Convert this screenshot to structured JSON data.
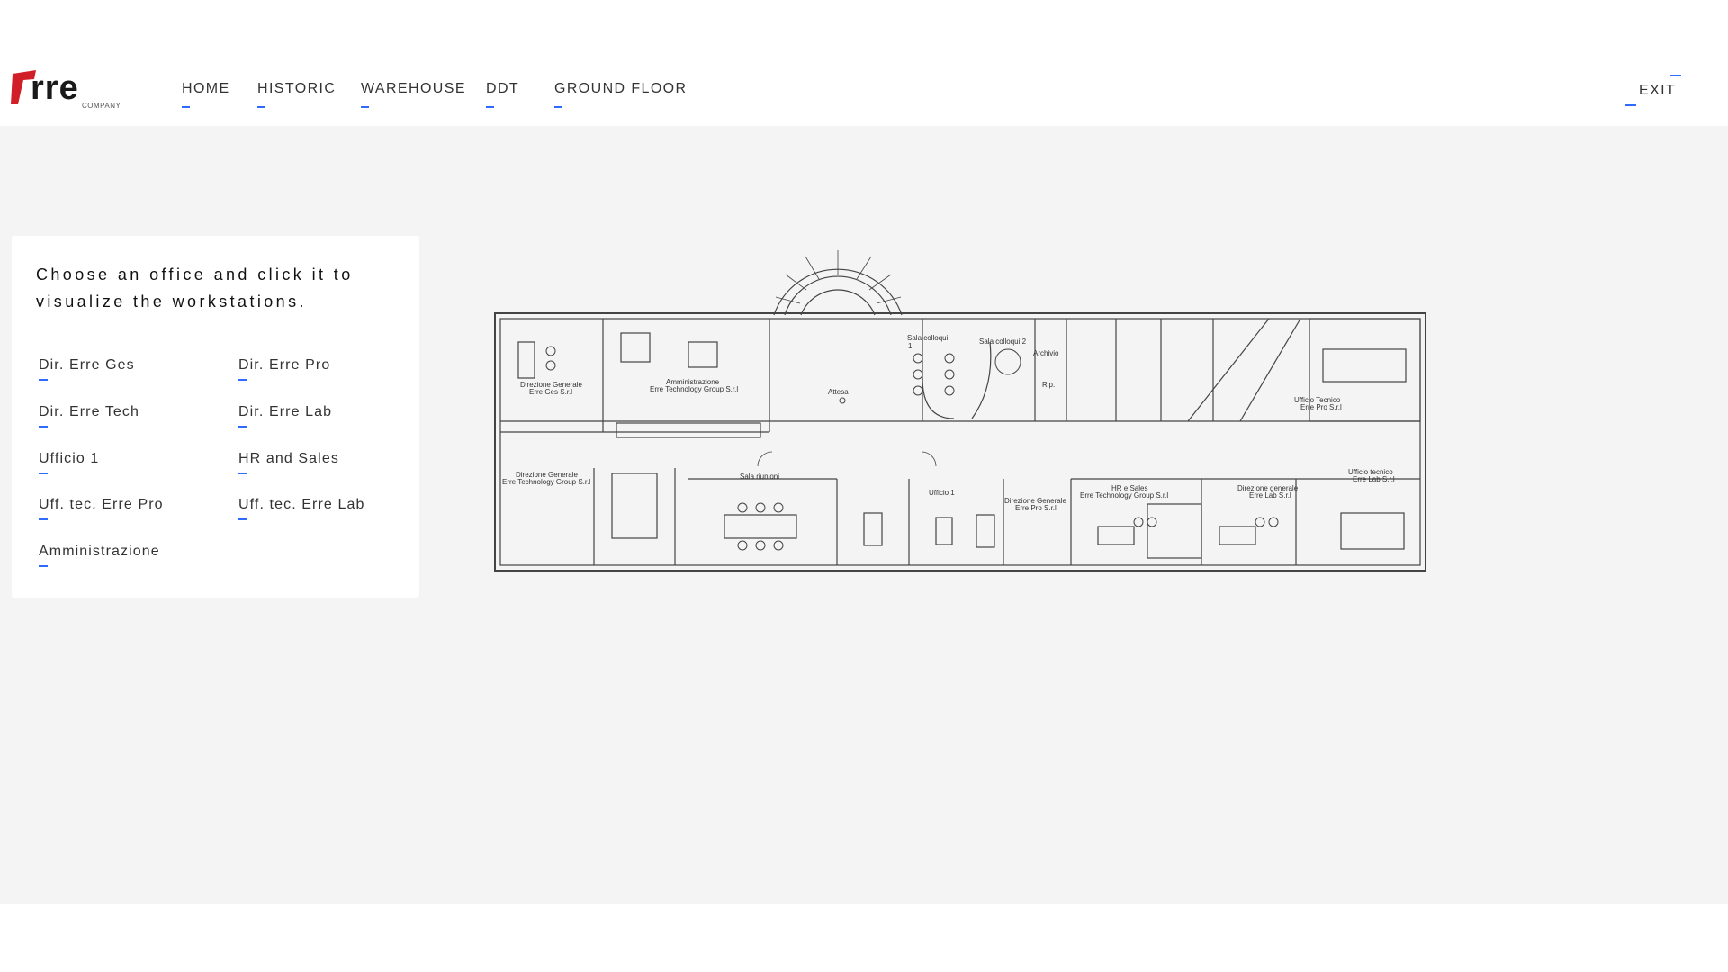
{
  "brand": {
    "name": "erre",
    "sub": "COMPANY",
    "accent": "#d01f26"
  },
  "nav": {
    "items": [
      "HOME",
      "HISTORIC",
      "WAREHOUSE",
      "DDT",
      "GROUND FLOOR"
    ],
    "exit": "EXIT",
    "underline_color": "#2f6bff"
  },
  "panel": {
    "title": "Choose an office and click it to visualize the workstations.",
    "offices": [
      "Dir. Erre Ges",
      "Dir. Erre Pro",
      "Dir. Erre Tech",
      "Dir. Erre Lab",
      "Ufficio 1",
      "HR and Sales",
      "Uff. tec. Erre Pro",
      "Uff. tec. Erre Lab",
      "Amministrazione"
    ]
  },
  "floorplan": {
    "labels": {
      "dir_generale_ges": "Direzione Generale",
      "dir_generale_ges_2": "Erre Ges S.r.l",
      "amministrazione": "Amministrazione",
      "amministrazione_2": "Erre Technology Group S.r.l",
      "attesa": "Attesa",
      "sala_colloqui_1": "Sala colloqui",
      "sala_colloqui_1b": "1",
      "sala_colloqui_2": "Sala colloqui 2",
      "archivio": "Archivio",
      "rip": "Rip.",
      "uff_tec_pro": "Ufficio Tecnico",
      "uff_tec_pro_2": "Erre Pro S.r.l",
      "dir_generale_tech": "Direzione Generale",
      "dir_generale_tech_2": "Erre Technology Group S.r.l",
      "sala_riunioni": "Sala riunioni",
      "ufficio_1": "Ufficio 1",
      "dir_generale_pro": "Direzione Generale",
      "dir_generale_pro_2": "Erre Pro S.r.l",
      "hr_sales": "HR e Sales",
      "hr_sales_2": "Erre Technology Group S.r.l",
      "dir_generale_lab": "Direzione generale",
      "dir_generale_lab_2": "Erre Lab S.r.l",
      "uff_tec_lab": "Ufficio tecnico",
      "uff_tec_lab_2": "Erre Lab S.r.l"
    }
  }
}
